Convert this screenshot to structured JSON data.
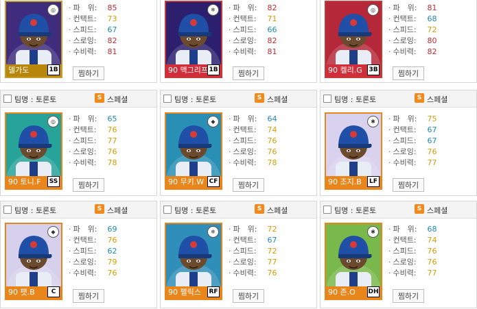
{
  "colors": {
    "stat_high": "#c1272d",
    "stat_mid": "#d89b00",
    "stat_low": "#1e88b6",
    "special_icon": "#f08a1c"
  },
  "team_label": "팀명 : 토론토",
  "special_label": "스페셜",
  "special_icon_text": "S",
  "button_label": "찜하기",
  "stat_labels": {
    "power": "파　위",
    "contact": "컨택트",
    "speed": "스피드",
    "throw": "스로잉",
    "defense": "수비력"
  },
  "cards": [
    {
      "name": "델가도",
      "pos": "1B",
      "badge": "",
      "stats": {
        "power": "85",
        "contact": "73",
        "speed": "67",
        "throw": "82",
        "defense": "81"
      },
      "frame": "#c79a2c",
      "bg": "#3f2c7d",
      "plate": "#b8860b",
      "header": false
    },
    {
      "name": "90 맥그리프",
      "pos": "1B",
      "badge": "❄",
      "stats": {
        "power": "82",
        "contact": "71",
        "speed": "66",
        "throw": "82",
        "defense": "81"
      },
      "frame": "#c63838",
      "bg": "#2b1f6e",
      "plate": "#cf2f3a",
      "header": false
    },
    {
      "name": "90 켈리.G",
      "pos": "3B",
      "badge": "",
      "stats": {
        "power": "81",
        "contact": "68",
        "speed": "72",
        "throw": "80",
        "defense": "82"
      },
      "frame": "#c63838",
      "bg": "#b5283a",
      "plate": "#cf2f3a",
      "header": false
    },
    {
      "name": "90 토니.F",
      "pos": "SS",
      "badge": "",
      "stats": {
        "power": "65",
        "contact": "76",
        "speed": "77",
        "throw": "76",
        "defense": "78"
      },
      "frame": "#e8851b",
      "bg": "#27a39a",
      "plate": "#e8851b",
      "header": true
    },
    {
      "name": "90 무키.W",
      "pos": "CF",
      "badge": "◆",
      "stats": {
        "power": "64",
        "contact": "74",
        "speed": "76",
        "throw": "76",
        "defense": "78"
      },
      "frame": "#e8851b",
      "bg": "#2a8fb5",
      "plate": "#e8851b",
      "header": true
    },
    {
      "name": "90 조지.B",
      "pos": "LF",
      "badge": "✱",
      "stats": {
        "power": "75",
        "contact": "67",
        "speed": "67",
        "throw": "76",
        "defense": "77"
      },
      "frame": "#e8851b",
      "bg": "#d9d2ee",
      "plate": "#e8851b",
      "header": true
    },
    {
      "name": "90 팻.B",
      "pos": "C",
      "badge": "◆",
      "stats": {
        "power": "69",
        "contact": "76",
        "speed": "62",
        "throw": "79",
        "defense": "76"
      },
      "frame": "#e8851b",
      "bg": "#d6d0ec",
      "plate": "#e8851b",
      "header": true
    },
    {
      "name": "90 펠릭스",
      "pos": "RF",
      "badge": "❄",
      "stats": {
        "power": "72",
        "contact": "67",
        "speed": "72",
        "throw": "77",
        "defense": "76"
      },
      "frame": "#e8851b",
      "bg": "#2f8fb8",
      "plate": "#e8851b",
      "header": true
    },
    {
      "name": "90 존.O",
      "pos": "DH",
      "badge": "✱",
      "stats": {
        "power": "68",
        "contact": "74",
        "speed": "76",
        "throw": "76",
        "defense": "77"
      },
      "frame": "#e8851b",
      "bg": "#79b84a",
      "plate": "#e8851b",
      "header": true
    }
  ]
}
